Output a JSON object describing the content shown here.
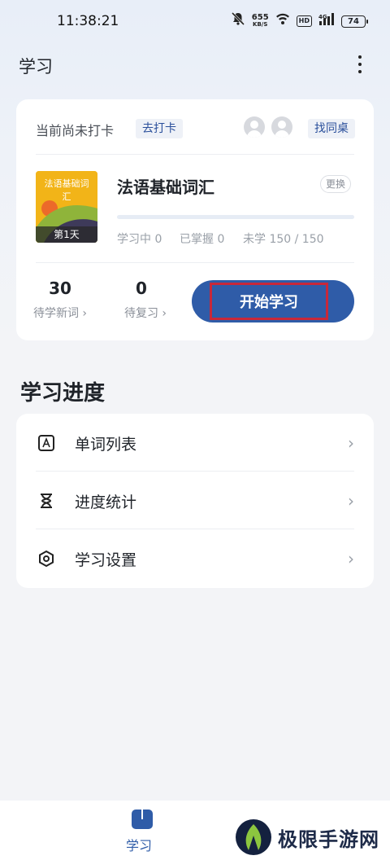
{
  "status_bar": {
    "time": "11:38:21",
    "net_speed_value": "655",
    "net_speed_unit": "KB/S",
    "hd_label": "HD",
    "signal_label": "4G",
    "battery": "74"
  },
  "header": {
    "title": "学习"
  },
  "checkin": {
    "status_text": "当前尚未打卡",
    "goto_checkin_label": "去打卡",
    "find_deskmate_label": "找同桌"
  },
  "book": {
    "cover_title": "法语基础词汇",
    "cover_day": "第1天",
    "name": "法语基础词汇",
    "change_label": "更换",
    "progress": 0,
    "stats": {
      "learning": "学习中 0",
      "mastered": "已掌握 0",
      "unlearned": "未学 150 / 150"
    }
  },
  "summary": {
    "new_words_count": "30",
    "new_words_label": "待学新词 ›",
    "review_count": "0",
    "review_label": "待复习 ›",
    "start_button_label": "开始学习"
  },
  "progress_section": {
    "title": "学习进度",
    "items": [
      {
        "label": "单词列表",
        "icon": "word-list-icon"
      },
      {
        "label": "进度统计",
        "icon": "hourglass-icon"
      },
      {
        "label": "学习设置",
        "icon": "settings-icon"
      }
    ],
    "chevron": "›"
  },
  "bottom_nav": {
    "tab_study_label": "学习"
  },
  "watermark": {
    "text": "极限手游网"
  },
  "colors": {
    "accent": "#2f5ca8",
    "highlight_border": "#c8283a",
    "cover": "#f2b418"
  }
}
